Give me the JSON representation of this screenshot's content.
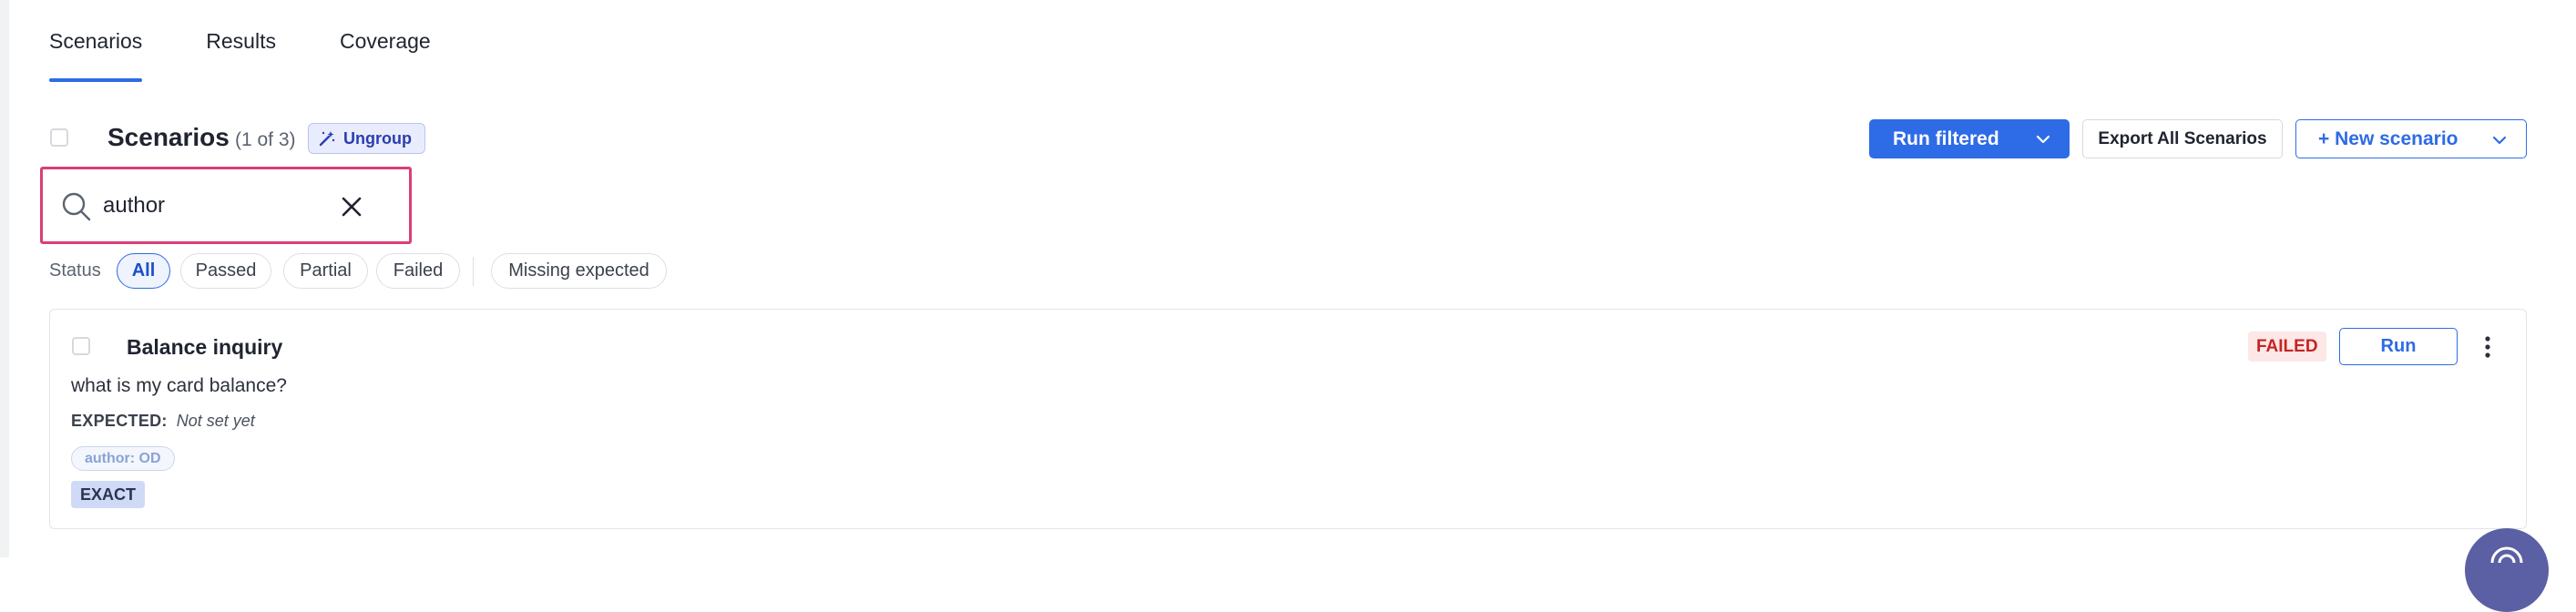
{
  "tabs": [
    {
      "label": "Scenarios",
      "active": true
    },
    {
      "label": "Results",
      "active": false
    },
    {
      "label": "Coverage",
      "active": false
    }
  ],
  "header": {
    "title": "Scenarios",
    "count": "(1 of 3)",
    "ungroup_label": "Ungroup",
    "run_filtered_label": "Run filtered",
    "export_label": "Export All Scenarios",
    "new_scenario_label": "+ New scenario"
  },
  "search": {
    "value": "author",
    "placeholder": ""
  },
  "status_filter": {
    "label": "Status",
    "options": [
      "All",
      "Passed",
      "Partial",
      "Failed",
      "Missing expected"
    ],
    "selected": "All"
  },
  "scenarios": [
    {
      "title": "Balance inquiry",
      "question": "what is my card balance?",
      "expected_label": "EXPECTED:",
      "expected_value": "Not set yet",
      "tag": "author: OD",
      "match_type": "EXACT",
      "status": "FAILED",
      "run_label": "Run"
    }
  ],
  "colors": {
    "accent": "#2e6be6",
    "search_highlight": "#d93f78",
    "failed_bg": "#fde7e7",
    "failed_text": "#c42424"
  },
  "icons": {
    "ungroup": "magic-wand-icon",
    "search": "search-icon",
    "clear": "close-icon",
    "dropdown": "chevron-down-icon",
    "more": "more-vertical-icon"
  }
}
